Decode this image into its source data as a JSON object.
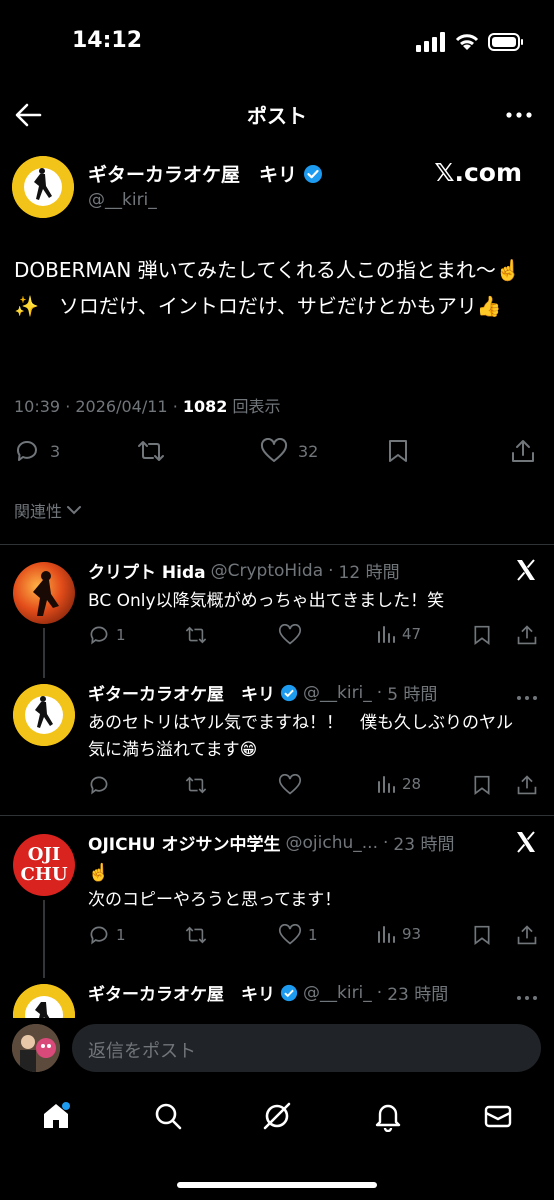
{
  "status_bar": {
    "time": "14:12"
  },
  "nav": {
    "title": "ポスト"
  },
  "post": {
    "author_name": "ギターカラオケ屋　キリ",
    "author_handle": "@__kiri_",
    "source_label": "𝕏.com",
    "text": "DOBERMAN  弾いてみたしてくれる人この指とまれ〜☝️ ✨　ソロだけ、イントロだけ、サビだけとかもアリ👍",
    "time": "10:39",
    "date": "2026/04/11",
    "views": "1082",
    "views_label": "回表示",
    "replies": "3",
    "likes": "32"
  },
  "relevance_label": "関連性",
  "replies": [
    {
      "name": "クリプト Hida",
      "handle": "@CryptoHida",
      "age": "12 時間",
      "text": "BC Only以降気概がめっちゃ出てきました！笑",
      "replies": "1",
      "retweets": "",
      "likes": "",
      "views": "47"
    },
    {
      "name": "ギターカラオケ屋　キリ",
      "handle": "@__kiri_",
      "age": "5 時間",
      "text": "あのセトリはヤル気でますね！！　僕も久しぶりのヤル気に満ち溢れてます😁",
      "replies": "",
      "retweets": "",
      "likes": "",
      "views": "28"
    },
    {
      "name": "OJICHU オジサン中学生",
      "handle": "@ojichu_...",
      "age": "23 時間",
      "text_line1": "☝️",
      "text_line2": "次のコピーやろうと思ってます！",
      "replies": "1",
      "retweets": "",
      "likes": "1",
      "views": "93",
      "avatar_text_top": "OJI",
      "avatar_text_bottom": "CHU"
    },
    {
      "name": "ギターカラオケ屋　キリ",
      "handle": "@__kiri_",
      "age": "23 時間"
    }
  ],
  "composer": {
    "placeholder": "返信をポスト"
  },
  "colors": {
    "background": "#000000",
    "verified": "#1d9bf0",
    "muted": "#71767b",
    "divider": "#2f3336",
    "badge_gold": "#f2c318"
  }
}
